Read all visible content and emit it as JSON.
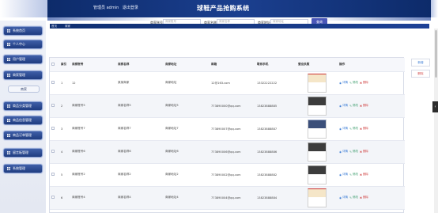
{
  "header": {
    "user_prefix": "管理员 admin",
    "logout": "退出登录",
    "app_title": "球鞋产品抢购系统"
  },
  "sidebar": {
    "items": [
      {
        "label": "系统首页"
      },
      {
        "label": "个人中心"
      },
      {
        "label": "用户管理"
      },
      {
        "label": "商家管理"
      },
      {
        "label": "商品分类管理"
      },
      {
        "label": "商品信息管理"
      },
      {
        "label": "商品订单管理"
      },
      {
        "label": "留言板管理"
      },
      {
        "label": "系统管理"
      }
    ],
    "sub_item": "商家"
  },
  "search": {
    "label1": "商家账号",
    "placeholder1": "商家账号",
    "label2": "商家名称",
    "placeholder2": "商家名称",
    "label3": "商家地址",
    "placeholder3": "商家地址",
    "button": "查询"
  },
  "breadcrumb": {
    "home": "首页",
    "current": "商家"
  },
  "table": {
    "headers": [
      "",
      "索引",
      "商家账号",
      "商家名称",
      "商家地址",
      "邮箱",
      "联系手机",
      "营业执照",
      "操作"
    ],
    "rows": [
      {
        "index": "1",
        "account": "12",
        "name": "某某商家",
        "address": "商家地址",
        "email": "12@163.com",
        "phone": "13322222222",
        "license": "red"
      },
      {
        "index": "2",
        "account": "商家账号5",
        "name": "商家名称5",
        "address": "商家地址5",
        "email": "773890000@qq.com",
        "phone": "13823888885",
        "license": "dark"
      },
      {
        "index": "3",
        "account": "商家账号7",
        "name": "商家名称7",
        "address": "商家地址7",
        "email": "773890007@qq.com",
        "phone": "13823888887",
        "license": "blue"
      },
      {
        "index": "4",
        "account": "商家账号6",
        "name": "商家名称6",
        "address": "商家地址6",
        "email": "773890006@qq.com",
        "phone": "13823888886",
        "license": "dark"
      },
      {
        "index": "5",
        "account": "商家账号2",
        "name": "商家名称2",
        "address": "商家地址2",
        "email": "773890002@qq.com",
        "phone": "13823888882",
        "license": "dark"
      },
      {
        "index": "6",
        "account": "商家账号4",
        "name": "商家名称4",
        "address": "商家地址4",
        "email": "773890004@qq.com",
        "phone": "13823888884",
        "license": "red"
      }
    ],
    "actions": {
      "view": "详情",
      "edit": "修改",
      "del": "删除"
    }
  },
  "right_buttons": {
    "add": "新增",
    "delete": "删除"
  },
  "colors": {
    "header_bg": "#1b3f8f",
    "sidebar_btn": "#2a4a92",
    "search_btn": "#4a57b8",
    "delete_red": "#d24a4a"
  },
  "icons": {
    "sidebar": "square-icon",
    "collapse": "chevron-left-icon"
  }
}
